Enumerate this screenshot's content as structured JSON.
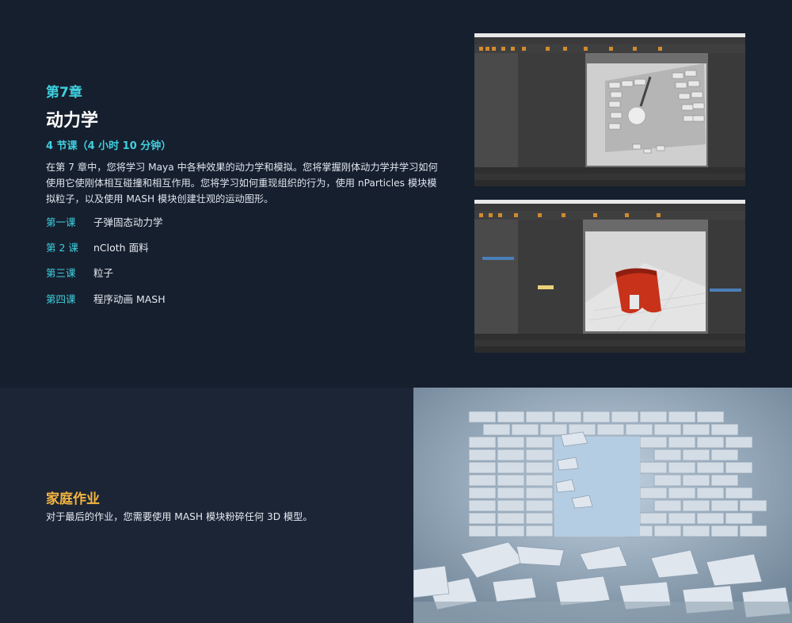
{
  "chapter": {
    "label": "第7章",
    "title": "动力学",
    "lessons_summary": "4 节课（4 小时 10 分钟）",
    "description": "在第 7 章中，您将学习 Maya 中各种效果的动力学和模拟。您将掌握刚体动力学并学习如何使用它使刚体相互碰撞和相互作用。您将学习如何重现组织的行为，使用 nParticles 模块模拟粒子，以及使用 MASH 模块创建壮观的运动图形。",
    "lessons": [
      {
        "num": "第一课",
        "name": "子弹固态动力学"
      },
      {
        "num": "第 2 课",
        "name": "nCloth 面料"
      },
      {
        "num": "第三课",
        "name": "粒子"
      },
      {
        "num": "第四课",
        "name": "程序动画 MASH"
      }
    ]
  },
  "homework": {
    "title": "家庭作业",
    "text": "对于最后的作业，您需要使用 MASH 模块粉碎任何 3D 模型。"
  },
  "colors": {
    "accent_cyan": "#3fd0df",
    "accent_orange": "#f4b63f",
    "background": "#161f2e"
  }
}
